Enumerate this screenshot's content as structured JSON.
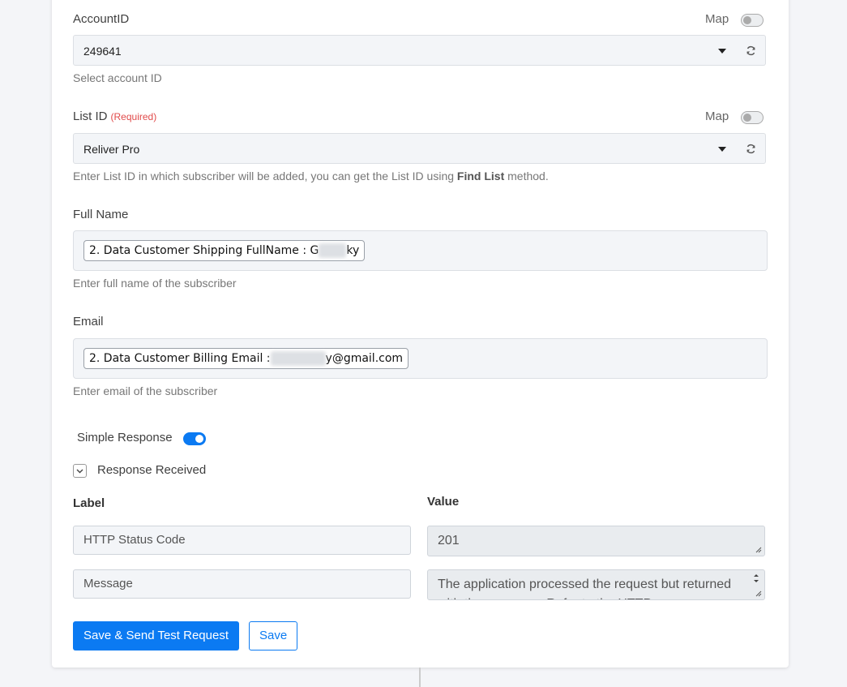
{
  "account": {
    "label": "AccountID",
    "map_label": "Map",
    "selected": "249641",
    "help": "Select account ID"
  },
  "list": {
    "label": "List ID",
    "required": "(Required)",
    "map_label": "Map",
    "selected": "Reliver Pro",
    "help_pre": "Enter List ID in which subscriber will be added, you can get the List ID using ",
    "help_bold": "Find List",
    "help_post": " method."
  },
  "full_name": {
    "label": "Full Name",
    "tag_prefix": "2. Data Customer Shipping FullName : G",
    "tag_suffix": "ky",
    "help": "Enter full name of the subscriber"
  },
  "email": {
    "label": "Email",
    "tag_prefix": "2. Data Customer Billing Email :",
    "tag_suffix": "y@gmail.com",
    "help": "Enter email of the subscriber"
  },
  "simple_response": {
    "label": "Simple Response",
    "enabled": true
  },
  "response_received": {
    "label": "Response Received"
  },
  "response_table": {
    "label_header": "Label",
    "value_header": "Value",
    "rows": [
      {
        "label": "HTTP Status Code",
        "value": "201"
      },
      {
        "label": "Message",
        "value": "The application processed the request but returned with the response. Refer to the HTTP"
      }
    ]
  },
  "buttons": {
    "save_send": "Save & Send Test Request",
    "save": "Save"
  },
  "colors": {
    "accent": "#0b7af2",
    "required": "#e14a4a"
  }
}
